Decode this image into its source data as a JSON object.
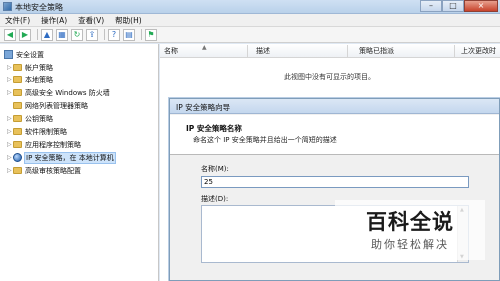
{
  "window": {
    "title": "本地安全策略",
    "buttons": {
      "minimize": "–",
      "maximize": "□",
      "close": "×"
    }
  },
  "menu": {
    "items": [
      "文件(F)",
      "操作(A)",
      "查看(V)",
      "帮助(H)"
    ]
  },
  "toolbar": {
    "icons": [
      "back-icon",
      "forward-icon",
      "up-folder-icon",
      "show-hide-tree-icon",
      "refresh-icon",
      "export-list-icon",
      "help-icon",
      "properties-icon",
      "policy-icon"
    ]
  },
  "tree": {
    "root": "安全设置",
    "items": [
      "帐户策略",
      "本地策略",
      "高级安全 Windows 防火墙",
      "网络列表管理器策略",
      "公钥策略",
      "软件限制策略",
      "应用程序控制策略",
      "IP 安全策略，在 本地计算机",
      "高级审核策略配置"
    ],
    "selected_index": 7
  },
  "list": {
    "columns": [
      "名称",
      "描述",
      "策略已指派",
      "上次更改时"
    ],
    "empty_message": "此视图中没有可显示的项目。"
  },
  "wizard": {
    "title": "IP 安全策略向导",
    "heading": "IP 安全策略名称",
    "subheading": "命名这个 IP 安全策略并且给出一个简短的描述",
    "name_label": "名称(M):",
    "name_value": "25",
    "description_label": "描述(D):",
    "description_value": ""
  },
  "watermark": {
    "main": "百科全说",
    "sub": "助你轻松解决"
  }
}
